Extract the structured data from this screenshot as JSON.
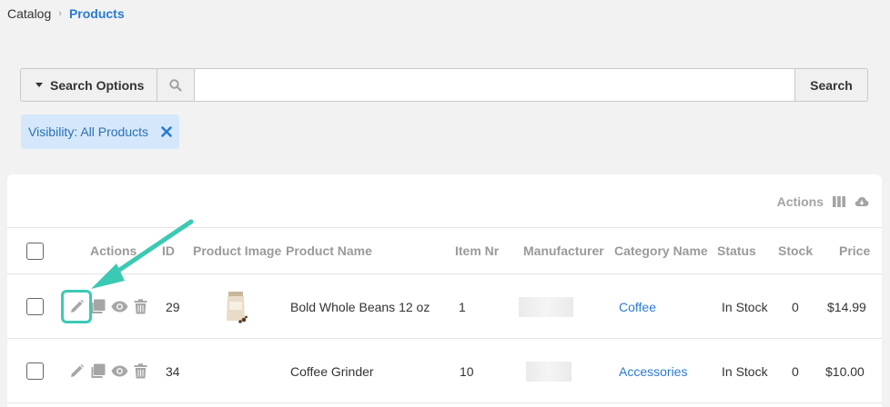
{
  "breadcrumb": {
    "parent": "Catalog",
    "current": "Products"
  },
  "search": {
    "options_label": "Search Options",
    "placeholder": "",
    "value": "",
    "button_label": "Search"
  },
  "filter": {
    "label": "Visibility: All Products"
  },
  "toolbar": {
    "actions_label": "Actions"
  },
  "table": {
    "headers": {
      "actions": "Actions",
      "id": "ID",
      "image": "Product Image",
      "name": "Product Name",
      "item_nr": "Item Nr",
      "manufacturer": "Manufacturer",
      "category": "Category Name",
      "status": "Status",
      "stock": "Stock",
      "price": "Price"
    },
    "rows": [
      {
        "id": "29",
        "name": "Bold Whole Beans 12 oz",
        "item_nr": "1",
        "category": "Coffee",
        "status": "In Stock",
        "stock": "0",
        "price": "$14.99"
      },
      {
        "id": "34",
        "name": "Coffee Grinder",
        "item_nr": "10",
        "category": "Accessories",
        "status": "In Stock",
        "stock": "0",
        "price": "$10.00"
      }
    ]
  },
  "colors": {
    "accent": "#2a7ad1",
    "annotation": "#3cc9b4",
    "chip_bg": "#d5e8fb"
  },
  "icons": [
    "chevron-right-icon",
    "caret-down-icon",
    "search-icon",
    "close-icon",
    "columns-icon",
    "cloud-download-icon",
    "pencil-icon",
    "copy-icon",
    "eye-icon",
    "trash-icon",
    "product-image"
  ]
}
